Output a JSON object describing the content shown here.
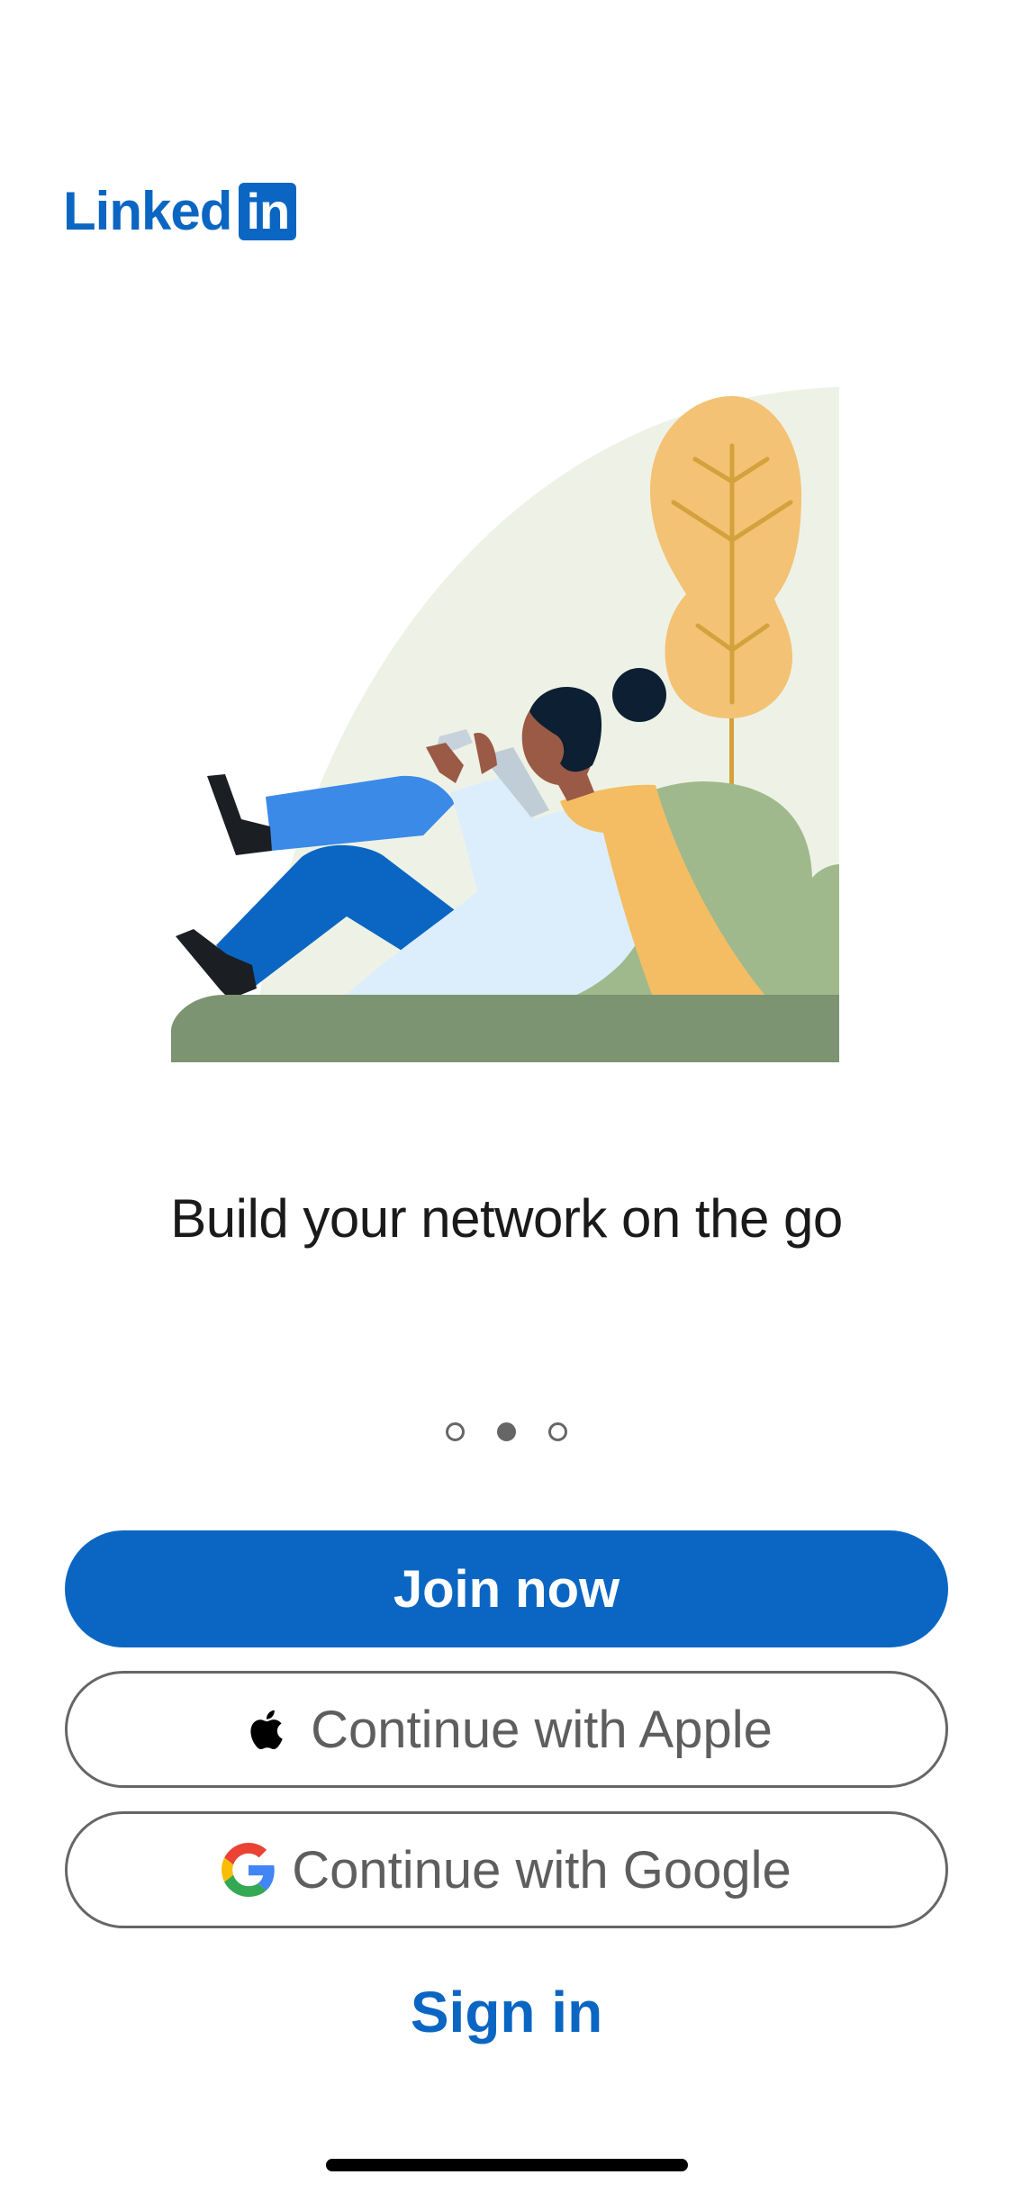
{
  "brand": {
    "logo_word": "Linked",
    "logo_box": "in",
    "color": "#0a66c2"
  },
  "onboarding": {
    "headline": "Build your network on the go",
    "pager": {
      "total": 3,
      "active_index": 1
    }
  },
  "actions": {
    "join_label": "Join now",
    "apple_label": "Continue with Apple",
    "google_label": "Continue with Google",
    "signin_label": "Sign in"
  },
  "icons": {
    "apple": "apple-logo-icon",
    "google": "google-logo-icon"
  }
}
